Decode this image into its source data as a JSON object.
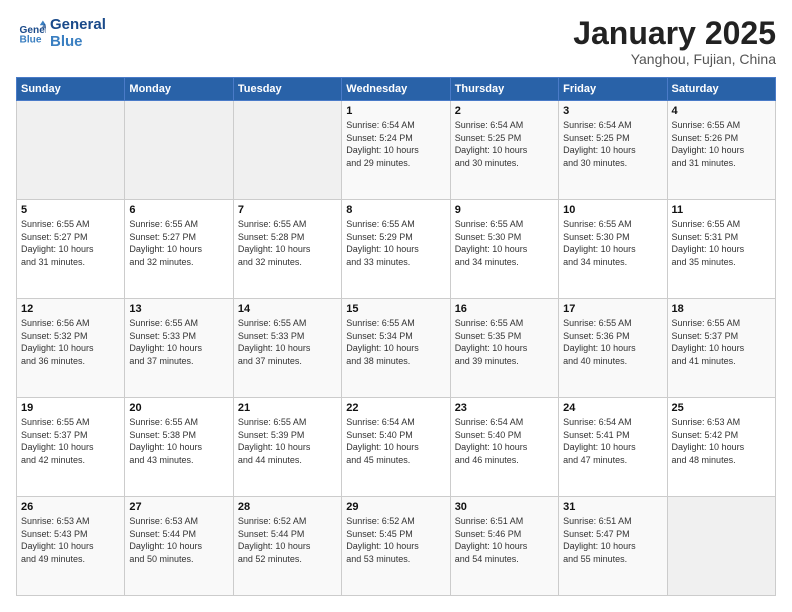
{
  "header": {
    "logo_line1": "General",
    "logo_line2": "Blue",
    "title": "January 2025",
    "location": "Yanghou, Fujian, China"
  },
  "days_of_week": [
    "Sunday",
    "Monday",
    "Tuesday",
    "Wednesday",
    "Thursday",
    "Friday",
    "Saturday"
  ],
  "weeks": [
    [
      {
        "day": "",
        "info": ""
      },
      {
        "day": "",
        "info": ""
      },
      {
        "day": "",
        "info": ""
      },
      {
        "day": "1",
        "info": "Sunrise: 6:54 AM\nSunset: 5:24 PM\nDaylight: 10 hours\nand 29 minutes."
      },
      {
        "day": "2",
        "info": "Sunrise: 6:54 AM\nSunset: 5:25 PM\nDaylight: 10 hours\nand 30 minutes."
      },
      {
        "day": "3",
        "info": "Sunrise: 6:54 AM\nSunset: 5:25 PM\nDaylight: 10 hours\nand 30 minutes."
      },
      {
        "day": "4",
        "info": "Sunrise: 6:55 AM\nSunset: 5:26 PM\nDaylight: 10 hours\nand 31 minutes."
      }
    ],
    [
      {
        "day": "5",
        "info": "Sunrise: 6:55 AM\nSunset: 5:27 PM\nDaylight: 10 hours\nand 31 minutes."
      },
      {
        "day": "6",
        "info": "Sunrise: 6:55 AM\nSunset: 5:27 PM\nDaylight: 10 hours\nand 32 minutes."
      },
      {
        "day": "7",
        "info": "Sunrise: 6:55 AM\nSunset: 5:28 PM\nDaylight: 10 hours\nand 32 minutes."
      },
      {
        "day": "8",
        "info": "Sunrise: 6:55 AM\nSunset: 5:29 PM\nDaylight: 10 hours\nand 33 minutes."
      },
      {
        "day": "9",
        "info": "Sunrise: 6:55 AM\nSunset: 5:30 PM\nDaylight: 10 hours\nand 34 minutes."
      },
      {
        "day": "10",
        "info": "Sunrise: 6:55 AM\nSunset: 5:30 PM\nDaylight: 10 hours\nand 34 minutes."
      },
      {
        "day": "11",
        "info": "Sunrise: 6:55 AM\nSunset: 5:31 PM\nDaylight: 10 hours\nand 35 minutes."
      }
    ],
    [
      {
        "day": "12",
        "info": "Sunrise: 6:56 AM\nSunset: 5:32 PM\nDaylight: 10 hours\nand 36 minutes."
      },
      {
        "day": "13",
        "info": "Sunrise: 6:55 AM\nSunset: 5:33 PM\nDaylight: 10 hours\nand 37 minutes."
      },
      {
        "day": "14",
        "info": "Sunrise: 6:55 AM\nSunset: 5:33 PM\nDaylight: 10 hours\nand 37 minutes."
      },
      {
        "day": "15",
        "info": "Sunrise: 6:55 AM\nSunset: 5:34 PM\nDaylight: 10 hours\nand 38 minutes."
      },
      {
        "day": "16",
        "info": "Sunrise: 6:55 AM\nSunset: 5:35 PM\nDaylight: 10 hours\nand 39 minutes."
      },
      {
        "day": "17",
        "info": "Sunrise: 6:55 AM\nSunset: 5:36 PM\nDaylight: 10 hours\nand 40 minutes."
      },
      {
        "day": "18",
        "info": "Sunrise: 6:55 AM\nSunset: 5:37 PM\nDaylight: 10 hours\nand 41 minutes."
      }
    ],
    [
      {
        "day": "19",
        "info": "Sunrise: 6:55 AM\nSunset: 5:37 PM\nDaylight: 10 hours\nand 42 minutes."
      },
      {
        "day": "20",
        "info": "Sunrise: 6:55 AM\nSunset: 5:38 PM\nDaylight: 10 hours\nand 43 minutes."
      },
      {
        "day": "21",
        "info": "Sunrise: 6:55 AM\nSunset: 5:39 PM\nDaylight: 10 hours\nand 44 minutes."
      },
      {
        "day": "22",
        "info": "Sunrise: 6:54 AM\nSunset: 5:40 PM\nDaylight: 10 hours\nand 45 minutes."
      },
      {
        "day": "23",
        "info": "Sunrise: 6:54 AM\nSunset: 5:40 PM\nDaylight: 10 hours\nand 46 minutes."
      },
      {
        "day": "24",
        "info": "Sunrise: 6:54 AM\nSunset: 5:41 PM\nDaylight: 10 hours\nand 47 minutes."
      },
      {
        "day": "25",
        "info": "Sunrise: 6:53 AM\nSunset: 5:42 PM\nDaylight: 10 hours\nand 48 minutes."
      }
    ],
    [
      {
        "day": "26",
        "info": "Sunrise: 6:53 AM\nSunset: 5:43 PM\nDaylight: 10 hours\nand 49 minutes."
      },
      {
        "day": "27",
        "info": "Sunrise: 6:53 AM\nSunset: 5:44 PM\nDaylight: 10 hours\nand 50 minutes."
      },
      {
        "day": "28",
        "info": "Sunrise: 6:52 AM\nSunset: 5:44 PM\nDaylight: 10 hours\nand 52 minutes."
      },
      {
        "day": "29",
        "info": "Sunrise: 6:52 AM\nSunset: 5:45 PM\nDaylight: 10 hours\nand 53 minutes."
      },
      {
        "day": "30",
        "info": "Sunrise: 6:51 AM\nSunset: 5:46 PM\nDaylight: 10 hours\nand 54 minutes."
      },
      {
        "day": "31",
        "info": "Sunrise: 6:51 AM\nSunset: 5:47 PM\nDaylight: 10 hours\nand 55 minutes."
      },
      {
        "day": "",
        "info": ""
      }
    ]
  ]
}
